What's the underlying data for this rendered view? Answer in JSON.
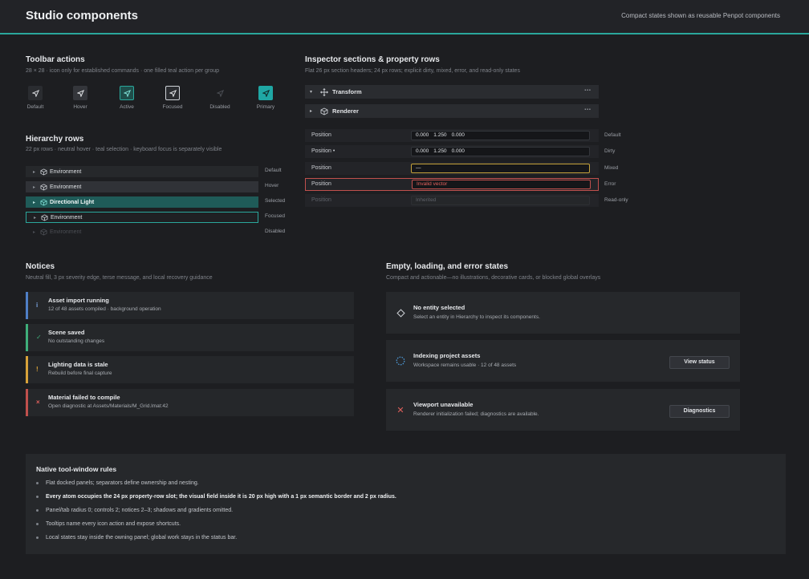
{
  "header": {
    "title": "Studio components",
    "subtitle": "Compact states shown as reusable Penpot components"
  },
  "toolbar": {
    "title": "Toolbar actions",
    "subtitle": "28 × 28 · icon only for established commands · one filled teal action per group",
    "items": [
      {
        "label": "Default"
      },
      {
        "label": "Hover"
      },
      {
        "label": "Active"
      },
      {
        "label": "Focused"
      },
      {
        "label": "Disabled"
      },
      {
        "label": "Primary"
      }
    ]
  },
  "hierarchy": {
    "title": "Hierarchy rows",
    "subtitle": "22 px rows · neutral hover · teal selection · keyboard focus is separately visible",
    "rows": [
      {
        "name": "Environment",
        "state": "Default"
      },
      {
        "name": "Environment",
        "state": "Hover"
      },
      {
        "name": "Directional Light",
        "state": "Selected"
      },
      {
        "name": "Environment",
        "state": "Focused"
      },
      {
        "name": "Environment",
        "state": "Disabled"
      }
    ]
  },
  "inspector": {
    "title": "Inspector sections & property rows",
    "subtitle": "Flat 26 px section headers; 24 px rows; explicit dirty, mixed, error, and read-only states",
    "sections": [
      {
        "label": "Transform",
        "icon": "move-icon",
        "more": "⋯"
      },
      {
        "label": "Renderer",
        "icon": "cube-icon",
        "more": "⋯"
      }
    ],
    "rows": [
      {
        "label": "Position",
        "values": [
          "0.000",
          "1.250",
          "0.000"
        ],
        "text": "",
        "state": "Default"
      },
      {
        "label": "Position •",
        "values": [
          "0.000",
          "1.250",
          "0.000"
        ],
        "text": "",
        "state": "Dirty"
      },
      {
        "label": "Position",
        "values": [],
        "text": "—",
        "state": "Mixed"
      },
      {
        "label": "Position",
        "values": [],
        "text": "Invalid vector",
        "state": "Error"
      },
      {
        "label": "Position",
        "values": [],
        "text": "Inherited",
        "state": "Read-only"
      }
    ]
  },
  "notices": {
    "title": "Notices",
    "subtitle": "Neutral fill, 3 px severity edge, terse message, and local recovery guidance",
    "items": [
      {
        "icon": "i",
        "title": "Asset import running",
        "desc": "12 of 48 assets compiled · background operation",
        "color": "#4f7fc6"
      },
      {
        "icon": "✓",
        "title": "Scene saved",
        "desc": "No outstanding changes",
        "color": "#3fae7a"
      },
      {
        "icon": "!",
        "title": "Lighting data is stale",
        "desc": "Rebuild before final capture",
        "color": "#d8a23a"
      },
      {
        "icon": "×",
        "title": "Material failed to compile",
        "desc": "Open diagnostic at Assets/Materials/M_Grid.lmat:42",
        "color": "#c0504d"
      }
    ]
  },
  "states": {
    "title": "Empty, loading, and error states",
    "subtitle": "Compact and actionable—no illustrations, decorative cards, or blocked global overlays",
    "cards": [
      {
        "title": "No entity selected",
        "desc": "Select an entity in Hierarchy to inspect its components.",
        "button": ""
      },
      {
        "title": "Indexing project assets",
        "desc": "Workspace remains usable · 12 of 48 assets",
        "button": "View status"
      },
      {
        "title": "Viewport unavailable",
        "desc": "Renderer initialization failed; diagnostics are available.",
        "button": "Diagnostics"
      }
    ]
  },
  "rules": {
    "title": "Native tool-window rules",
    "items": [
      "Flat docked panels; separators define ownership and nesting.",
      "Every atom occupies the 24 px property-row slot; the visual field inside it is 20 px high with a 1 px semantic border and 2 px radius.",
      "Panel/tab radius 0; controls 2; notices 2–3; shadows and gradients omitted.",
      "Tooltips name every icon action and expose shortcuts.",
      "Local states stay inside the owning panel; global work stays in the status bar."
    ]
  },
  "colors": {
    "accent": "#2aa79c",
    "info": "#4f7fc6",
    "success": "#3fae7a",
    "warning": "#d8a23a",
    "error": "#c0504d"
  }
}
